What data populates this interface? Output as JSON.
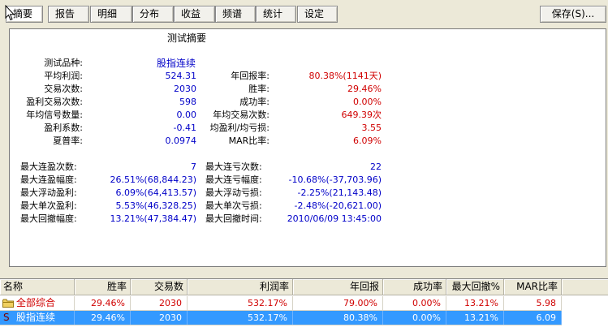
{
  "tabs": [
    {
      "label": "摘要",
      "active": true
    },
    {
      "label": "报告",
      "active": false
    },
    {
      "label": "明细",
      "active": false
    },
    {
      "label": "分布",
      "active": false
    },
    {
      "label": "收益",
      "active": false
    },
    {
      "label": "频谱",
      "active": false
    },
    {
      "label": "统计",
      "active": false
    },
    {
      "label": "设定",
      "active": false
    }
  ],
  "save_label": "保存(S)...",
  "summary": {
    "title": "测试摘要",
    "product_label": "测试品种:",
    "product_value": "股指连续",
    "rows_a": [
      {
        "l1": "平均利润:",
        "v1": "524.31",
        "l2": "年回报率:",
        "v2": "80.38%(1141天)"
      },
      {
        "l1": "交易次数:",
        "v1": "2030",
        "l2": "胜率:",
        "v2": "29.46%"
      },
      {
        "l1": "盈利交易次数:",
        "v1": "598",
        "l2": "成功率:",
        "v2": "0.00%"
      },
      {
        "l1": "年均信号数量:",
        "v1": "0.00",
        "l2": "年均交易次数:",
        "v2": "649.39次"
      },
      {
        "l1": "盈利系数:",
        "v1": "-0.41",
        "l2": "均盈利/均亏损:",
        "v2": "3.55"
      },
      {
        "l1": "夏普率:",
        "v1": "0.0974",
        "l2": "MAR比率:",
        "v2": "6.09%"
      }
    ],
    "rows_b": [
      {
        "l1": "最大连盈次数:",
        "v1": "7",
        "l2": "最大连亏次数:",
        "v2": "22"
      },
      {
        "l1": "最大连盈幅度:",
        "v1": "26.51%(68,844.23)",
        "l2": "最大连亏幅度:",
        "v2": "-10.68%(-37,703.96)"
      },
      {
        "l1": "最大浮动盈利:",
        "v1": "6.09%(64,413.57)",
        "l2": "最大浮动亏损:",
        "v2": "-2.25%(21,143.48)"
      },
      {
        "l1": "最大单次盈利:",
        "v1": "5.53%(46,328.25)",
        "l2": "最大单次亏损:",
        "v2": "-2.48%(-20,621.00)"
      },
      {
        "l1": "最大回撤幅度:",
        "v1": "13.21%(47,384.47)",
        "l2": "最大回撤时间:",
        "v2": "2010/06/09 13:45:00"
      }
    ]
  },
  "grid": {
    "headers": [
      "名称",
      "胜率",
      "交易数",
      "利润率",
      "年回报",
      "成功率",
      "最大回撤%",
      "MAR比率"
    ],
    "rows": [
      {
        "name": "全部综合",
        "icon": "folder-icon",
        "cells": [
          "29.46%",
          "2030",
          "532.17%",
          "79.00%",
          "0.00%",
          "13.21%",
          "5.98"
        ],
        "selected": false
      },
      {
        "name": "股指连续",
        "icon": "s-icon",
        "icon_text": "S",
        "cells": [
          "29.46%",
          "2030",
          "532.17%",
          "80.38%",
          "0.00%",
          "13.21%",
          "6.09"
        ],
        "selected": true
      }
    ]
  }
}
